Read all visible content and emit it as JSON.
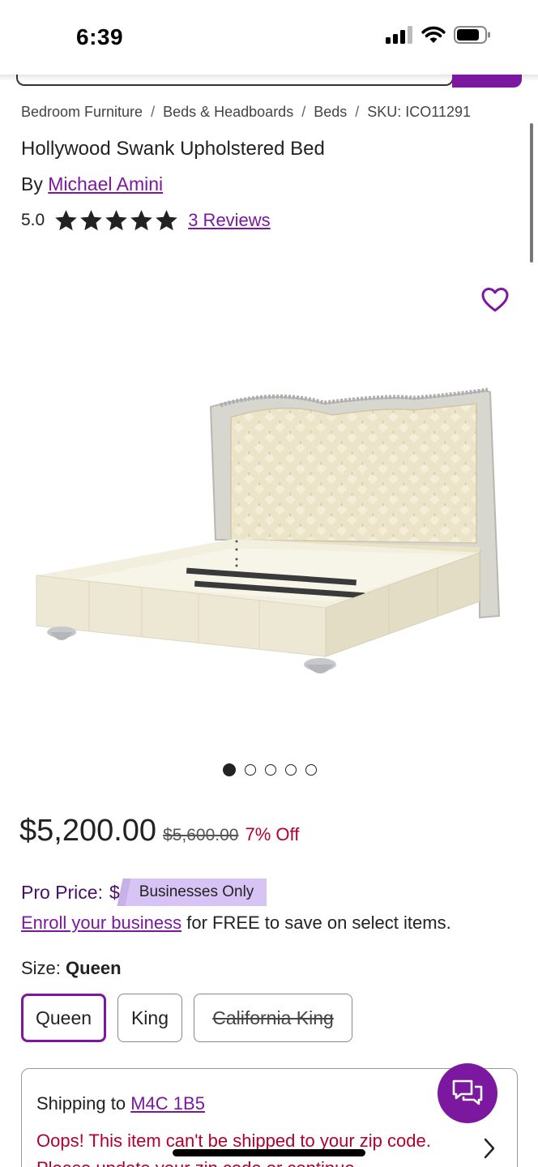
{
  "status": {
    "time": "6:39"
  },
  "breadcrumb": [
    "Bedroom Furniture",
    "Beds & Headboards",
    "Beds",
    "SKU: ICO11291"
  ],
  "breadcrumb_sep": "/",
  "product": {
    "title": "Hollywood Swank Upholstered Bed",
    "by_prefix": "By",
    "brand": "Michael Amini",
    "rating_value": "5.0",
    "stars": 5,
    "reviews_link": "3 Reviews"
  },
  "gallery": {
    "dot_count": 5,
    "active_index": 0
  },
  "pricing": {
    "price": "$5,200.00",
    "original_price": "$5,600.00",
    "discount": "7% Off",
    "pro_label": "Pro Price:",
    "pro_dollar": "$",
    "business_badge": "Businesses Only",
    "enroll_link": "Enroll your business",
    "enroll_suffix": " for FREE to save on select items."
  },
  "size": {
    "label": "Size:",
    "selected": "Queen",
    "options": [
      "Queen",
      "King",
      "California King"
    ]
  },
  "shipping": {
    "label": "Shipping to",
    "zip": "M4C 1B5",
    "error": "Oops! This item can't be shipped to your zip code. Please update your zip code or continue"
  },
  "colors": {
    "brand": "#7b189f",
    "error": "#b3002d",
    "badge": "#d8c3f5"
  }
}
